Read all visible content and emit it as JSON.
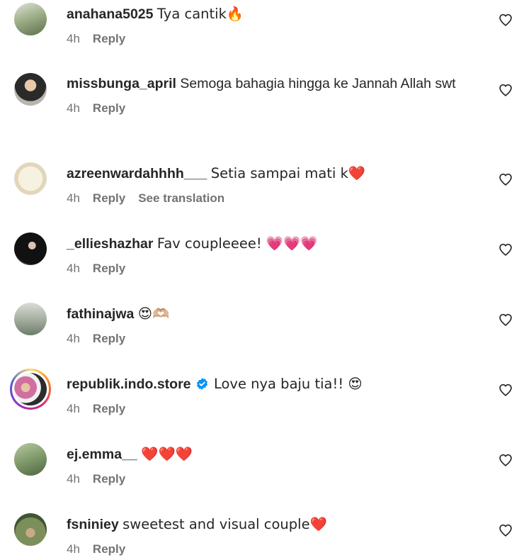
{
  "comments": [
    {
      "username": "anahana5025",
      "text": "Tya cantik🔥",
      "time": "4h",
      "reply_label": "Reply",
      "translate_label": ""
    },
    {
      "username": "missbunga_april",
      "text": "Semoga bahagia hingga ke Jannah Allah swt",
      "time": "4h",
      "reply_label": "Reply",
      "translate_label": ""
    },
    {
      "username": "azreenwardahhhh___",
      "text": "Setia sampai mati k❤️",
      "time": "4h",
      "reply_label": "Reply",
      "translate_label": "See translation"
    },
    {
      "username": "_ellieshazhar",
      "text": "Fav coupleeee! 💗💗💗",
      "time": "4h",
      "reply_label": "Reply",
      "translate_label": ""
    },
    {
      "username": "fathinajwa",
      "text": "😍🫶🏼",
      "time": "4h",
      "reply_label": "Reply",
      "translate_label": ""
    },
    {
      "username": "republik.indo.store",
      "verified": true,
      "text": "Love nya baju tia!! 😍",
      "time": "4h",
      "reply_label": "Reply",
      "translate_label": ""
    },
    {
      "username": "ej.emma__",
      "text": "❤️❤️❤️",
      "time": "4h",
      "reply_label": "Reply",
      "translate_label": ""
    },
    {
      "username": "fsniniey",
      "text": "sweetest and visual couple❤️",
      "time": "4h",
      "reply_label": "Reply",
      "translate_label": ""
    }
  ],
  "icons": {
    "like": "heart-outline-icon",
    "verified": "verified-badge-icon"
  },
  "colors": {
    "text": "#262626",
    "secondary": "#737373",
    "verified": "#0095f6",
    "background": "#ffffff"
  }
}
